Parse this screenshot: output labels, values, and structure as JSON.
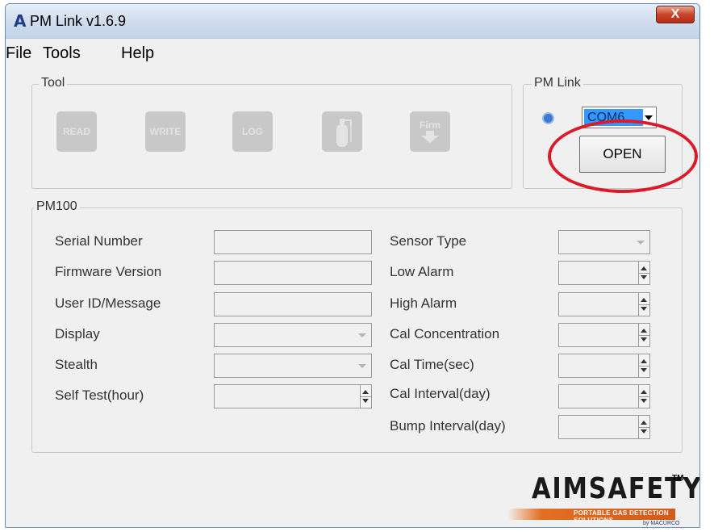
{
  "window": {
    "logo_letter": "A",
    "title": "PM Link v1.6.9",
    "close_symbol": "X"
  },
  "menu": [
    "File",
    "Tools",
    "Help"
  ],
  "tool_group": {
    "legend": "Tool",
    "buttons": [
      "READ",
      "WRITE",
      "LOG",
      "",
      "Firm"
    ]
  },
  "pmlink_group": {
    "legend": "PM Link",
    "port_value": "COM6",
    "open_label": "OPEN"
  },
  "device_group": {
    "legend": "PM100",
    "left_fields": [
      {
        "label": "Serial Number",
        "kind": "text",
        "value": ""
      },
      {
        "label": "Firmware Version",
        "kind": "text",
        "value": ""
      },
      {
        "label": "User ID/Message",
        "kind": "text",
        "value": ""
      },
      {
        "label": "Display",
        "kind": "combo",
        "value": ""
      },
      {
        "label": "Stealth",
        "kind": "combo",
        "value": ""
      },
      {
        "label": "Self Test(hour)",
        "kind": "spin",
        "value": ""
      }
    ],
    "right_fields": [
      {
        "label": "Sensor Type",
        "kind": "combo",
        "value": ""
      },
      {
        "label": "Low Alarm",
        "kind": "spin",
        "value": ""
      },
      {
        "label": "High Alarm",
        "kind": "spin",
        "value": ""
      },
      {
        "label": "Cal Concentration",
        "kind": "spin",
        "value": ""
      },
      {
        "label": "Cal Time(sec)",
        "kind": "spin",
        "value": ""
      },
      {
        "label": "Cal Interval(day)",
        "kind": "spin",
        "value": ""
      },
      {
        "label": "Bump Interval(day)",
        "kind": "spin",
        "value": ""
      }
    ]
  },
  "branding": {
    "name": "AIMSAFETY",
    "trademark": "TM",
    "tagline": "PORTABLE GAS DETECTION SOLUTIONS",
    "sub": "by MACURCO"
  }
}
